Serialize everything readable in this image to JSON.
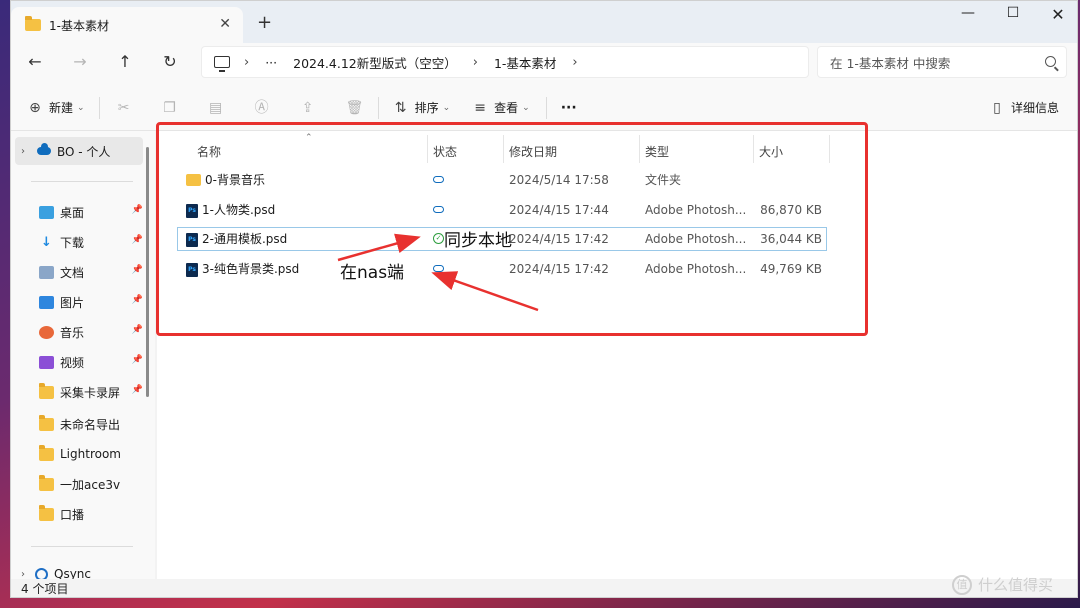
{
  "window": {
    "tab_title": "1-基本素材",
    "tab_close": "✕",
    "new_tab": "+",
    "controls": {
      "min": "—",
      "max": "☐",
      "close": "✕"
    }
  },
  "nav": {
    "back": "←",
    "forward": "→",
    "up": "↑",
    "refresh": "↻"
  },
  "address": {
    "ellipsis": "···",
    "crumbs": [
      "2024.4.12新型版式（空空）",
      "1-基本素材"
    ],
    "chevron": "›"
  },
  "search": {
    "placeholder": "在 1-基本素材 中搜索"
  },
  "toolbar": {
    "new_label": "新建",
    "sort_label": "排序",
    "view_label": "查看",
    "more_label": "···",
    "details_label": "详细信息"
  },
  "sidebar": {
    "top_label": "BO - 个人",
    "quick_items": [
      {
        "label": "桌面",
        "icon": "desktop-icon",
        "pinned": true
      },
      {
        "label": "下载",
        "icon": "download-icon",
        "pinned": true
      },
      {
        "label": "文档",
        "icon": "document-icon",
        "pinned": true
      },
      {
        "label": "图片",
        "icon": "pictures-icon",
        "pinned": true
      },
      {
        "label": "音乐",
        "icon": "music-icon",
        "pinned": true
      },
      {
        "label": "视频",
        "icon": "video-icon",
        "pinned": true
      },
      {
        "label": "采集卡录屏",
        "icon": "folder-icon",
        "pinned": true
      },
      {
        "label": "未命名导出",
        "icon": "folder-icon",
        "pinned": false
      },
      {
        "label": "Lightroom",
        "icon": "folder-icon",
        "pinned": false
      },
      {
        "label": "一加ace3v",
        "icon": "folder-icon",
        "pinned": false
      },
      {
        "label": "口播",
        "icon": "folder-icon",
        "pinned": false
      }
    ],
    "bottom_label": "Qsync"
  },
  "columns": {
    "name": "名称",
    "status": "状态",
    "modified": "修改日期",
    "type": "类型",
    "size": "大小"
  },
  "files": [
    {
      "name": "0-背景音乐",
      "kind": "folder",
      "status": "cloud",
      "modified": "2024/5/14 17:58",
      "type": "文件夹",
      "size": ""
    },
    {
      "name": "1-人物类.psd",
      "kind": "psd",
      "status": "cloud",
      "modified": "2024/4/15 17:44",
      "type": "Adobe Photosh...",
      "size": "86,870 KB"
    },
    {
      "name": "2-通用模板.psd",
      "kind": "psd",
      "status": "synced",
      "modified": "2024/4/15 17:42",
      "type": "Adobe Photosh...",
      "size": "36,044 KB"
    },
    {
      "name": "3-纯色背景类.psd",
      "kind": "psd",
      "status": "cloud",
      "modified": "2024/4/15 17:42",
      "type": "Adobe Photosh...",
      "size": "49,769 KB"
    }
  ],
  "statusbar": {
    "count": "4 个项目"
  },
  "annotations": {
    "local_sync": "同步本地",
    "on_nas": "在nas端"
  },
  "watermark": {
    "text": "什么值得买",
    "logo": "值"
  },
  "colors": {
    "accent": "#0f6cbd",
    "annotation": "#e8312f",
    "synced": "#2e9e3f",
    "folder": "#f5c143"
  }
}
